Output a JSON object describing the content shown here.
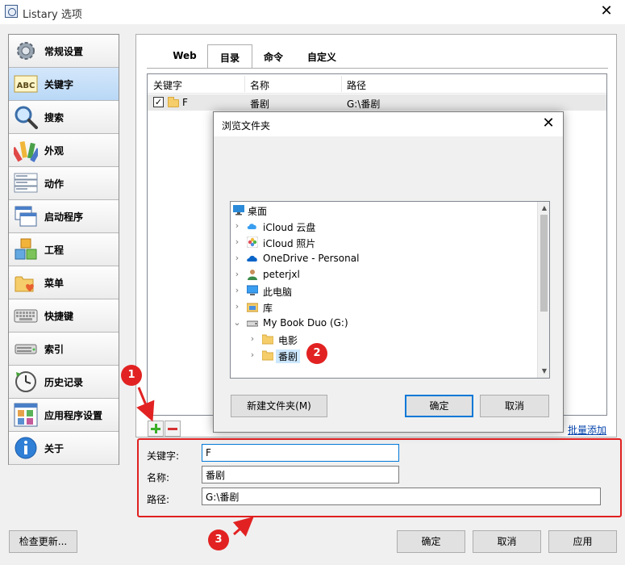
{
  "window": {
    "title": "Listary 选项",
    "close_glyph": "✕"
  },
  "sidebar": {
    "items": [
      {
        "label": "常规设置",
        "icon": "gear-icon"
      },
      {
        "label": "关键字",
        "icon": "abc-icon",
        "active": true
      },
      {
        "label": "搜索",
        "icon": "magnifier-icon"
      },
      {
        "label": "外观",
        "icon": "palette-icon"
      },
      {
        "label": "动作",
        "icon": "action-list-icon"
      },
      {
        "label": "启动程序",
        "icon": "windows-icon"
      },
      {
        "label": "工程",
        "icon": "cubes-icon"
      },
      {
        "label": "菜单",
        "icon": "folder-heart-icon"
      },
      {
        "label": "快捷键",
        "icon": "keyboard-icon"
      },
      {
        "label": "索引",
        "icon": "drive-icon"
      },
      {
        "label": "历史记录",
        "icon": "clock-icon"
      },
      {
        "label": "应用程序设置",
        "icon": "app-grid-icon"
      },
      {
        "label": "关于",
        "icon": "info-icon"
      }
    ]
  },
  "tabs": [
    {
      "label": "Web"
    },
    {
      "label": "目录",
      "active": true
    },
    {
      "label": "命令"
    },
    {
      "label": "自定义"
    }
  ],
  "list": {
    "columns": [
      "关键字",
      "名称",
      "路径"
    ],
    "rows": [
      {
        "checked": true,
        "check_glyph": "✓",
        "keyword": "F",
        "name": "番剧",
        "path": "G:\\番剧"
      }
    ]
  },
  "batch_add_label": "批量添加",
  "fields": {
    "keyword_label": "关键字:",
    "keyword_value": "F",
    "name_label": "名称:",
    "name_value": "番剧",
    "path_label": "路径:",
    "path_value": "G:\\番剧"
  },
  "bottom_buttons": {
    "check_update": "检查更新...",
    "ok": "确定",
    "cancel": "取消",
    "apply": "应用"
  },
  "dialog": {
    "title": "浏览文件夹",
    "close_glyph": "✕",
    "tree": [
      {
        "label": "桌面",
        "level": 0,
        "chevron": "",
        "icon": "desktop-icon"
      },
      {
        "label": "iCloud 云盘",
        "level": 1,
        "chevron": "›",
        "icon": "icloud-drive-icon"
      },
      {
        "label": "iCloud 照片",
        "level": 1,
        "chevron": "›",
        "icon": "icloud-photos-icon"
      },
      {
        "label": "OneDrive - Personal",
        "level": 1,
        "chevron": "›",
        "icon": "onedrive-icon"
      },
      {
        "label": "peterjxl",
        "level": 1,
        "chevron": "›",
        "icon": "user-icon"
      },
      {
        "label": "此电脑",
        "level": 1,
        "chevron": "›",
        "icon": "computer-icon"
      },
      {
        "label": "库",
        "level": 1,
        "chevron": "›",
        "icon": "library-icon"
      },
      {
        "label": "My Book Duo (G:)",
        "level": 1,
        "chevron": "⌄",
        "icon": "drive-icon"
      },
      {
        "label": "电影",
        "level": 2,
        "chevron": "›",
        "icon": "folder-icon"
      },
      {
        "label": "番剧",
        "level": 2,
        "chevron": "›",
        "icon": "folder-icon",
        "selected": true
      }
    ],
    "new_folder_button": "新建文件夹(M)",
    "ok_button": "确定",
    "cancel_button": "取消",
    "scroll_up_glyph": "▲",
    "scroll_down_glyph": "▼"
  },
  "annotations": {
    "badge1": "1",
    "badge2": "2",
    "badge3": "3",
    "color": "#e22222"
  },
  "colors": {
    "accent": "#0078d7",
    "selected_bg": "#cce8ff",
    "link": "#0645ad",
    "highlight_border": "#e02020"
  }
}
